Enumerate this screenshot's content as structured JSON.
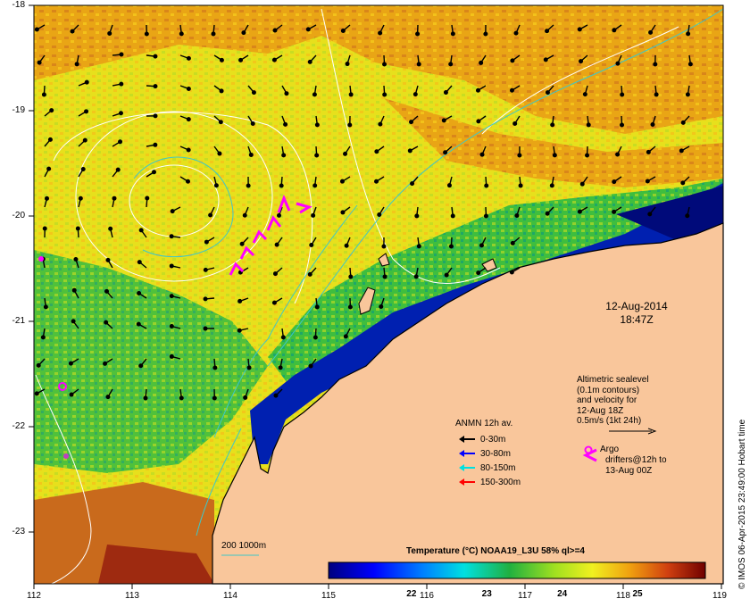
{
  "map": {
    "x_ticks": [
      "112",
      "113",
      "114",
      "115",
      "116",
      "117",
      "118",
      "119"
    ],
    "y_ticks": [
      "-18",
      "-19",
      "-20",
      "-21",
      "-22",
      "-23"
    ],
    "lon_range": [
      112,
      119
    ],
    "lat_range": [
      -23.6,
      -18
    ],
    "colors": {
      "land": "#f9c69b",
      "warm_sst": "#f0a11a",
      "mid_sst": "#e6e21a",
      "cool_sst": "#1fae50",
      "cold_sst": "#0018a8",
      "contour": "#ffffff",
      "isobath": "#3fc7c7",
      "drifter": "#ff00ff"
    }
  },
  "datetime": {
    "date": "12-Aug-2014",
    "time": "18:47Z"
  },
  "altimetry": {
    "lines": [
      "Altimetric sealevel",
      "(0.1m contours)",
      "and velocity for",
      "12-Aug 18Z",
      "0.5m/s (1kt 24h)"
    ]
  },
  "anmn": {
    "title": "ANMN 12h av.",
    "items": [
      {
        "label": "0-30m",
        "color": "#000000"
      },
      {
        "label": "30-80m",
        "color": "#0000ff"
      },
      {
        "label": "80-150m",
        "color": "#00e0e0"
      },
      {
        "label": "150-300m",
        "color": "#ff0000"
      }
    ]
  },
  "argo": {
    "label": "Argo"
  },
  "drifters": {
    "label_line1": "drifters@12h to",
    "label_line2": "13-Aug 00Z"
  },
  "isobath": {
    "label": "200  1000m"
  },
  "colorbar": {
    "title": "Temperature (°C) NOAA19_L3U 58% ql>=4",
    "ticks": [
      "22",
      "23",
      "24",
      "25"
    ],
    "tick_values": [
      22,
      23,
      24,
      25
    ],
    "range": [
      20.9,
      25.9
    ]
  },
  "credit": "© IMOS 06-Apr-2015 23:49:00 Hobart time"
}
